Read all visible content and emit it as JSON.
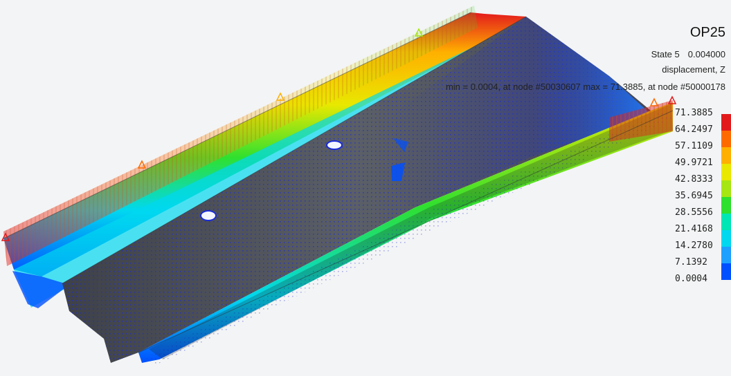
{
  "title": "OP25",
  "state": {
    "label": "State 5",
    "time": "0.004000"
  },
  "result_type": "displacement, Z",
  "minmax_text": "min = 0.0004, at node #50030607  max = 71.3885, at node #50000178",
  "legend": {
    "ticks": [
      "71.3885",
      "64.2497",
      "57.1109",
      "49.9721",
      "42.8333",
      "35.6945",
      "28.5556",
      "21.4168",
      "14.2780",
      "7.1392",
      "0.0004"
    ],
    "colors": [
      "#e31a1c",
      "#ff6a00",
      "#ffb000",
      "#e8e800",
      "#a6e612",
      "#2fe02f",
      "#00e6b4",
      "#00d8f0",
      "#1ea0ff",
      "#0050ff"
    ]
  },
  "colors": {
    "background": "#f3f4f5",
    "mesh": "#5a5d63",
    "vectors": "#1a2bd8"
  }
}
